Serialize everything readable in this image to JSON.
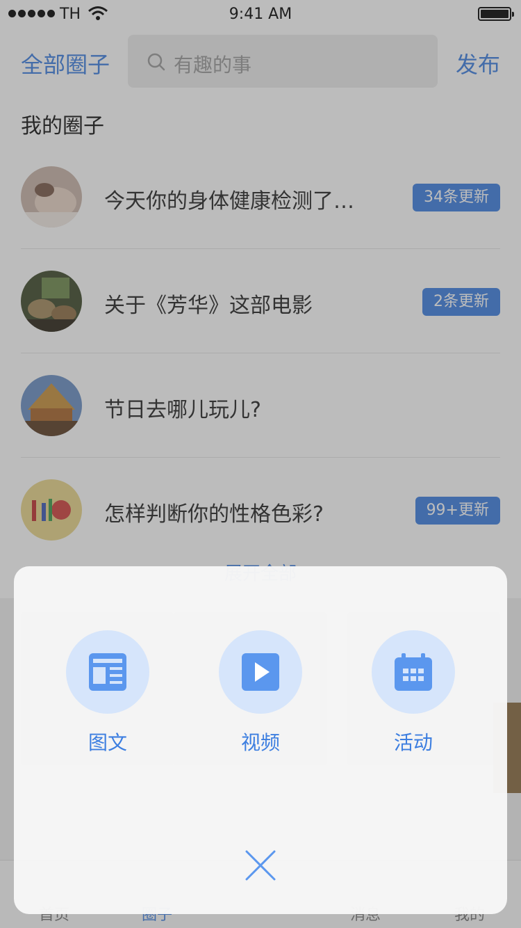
{
  "status_bar": {
    "carrier": "TH",
    "time": "9:41 AM"
  },
  "header": {
    "left_label": "全部圈子",
    "search_placeholder": "有趣的事",
    "right_label": "发布"
  },
  "section_title": "我的圈子",
  "circles": [
    {
      "title": "今天你的身体健康检测了…",
      "badge": "34条更新",
      "avatar": "spa-photo"
    },
    {
      "title": "关于《芳华》这部电影",
      "badge": "2条更新",
      "avatar": "movie-photo"
    },
    {
      "title": "节日去哪儿玩儿?",
      "badge": "",
      "avatar": "temple-photo"
    },
    {
      "title": "怎样判断你的性格色彩?",
      "badge": "99+更新",
      "avatar": "personality-photo"
    }
  ],
  "expand_all": "展开全部",
  "tab_bar": [
    "首页",
    "圈子",
    "",
    "消息",
    "我的"
  ],
  "action_sheet": {
    "actions": [
      {
        "label": "图文",
        "icon": "article-icon"
      },
      {
        "label": "视频",
        "icon": "video-play-icon"
      },
      {
        "label": "活动",
        "icon": "calendar-icon"
      }
    ],
    "close_icon": "close-icon"
  },
  "colors": {
    "accent": "#3c7ee0",
    "icon_bg": "#d6e5fb",
    "icon_fill": "#5b97ee"
  }
}
